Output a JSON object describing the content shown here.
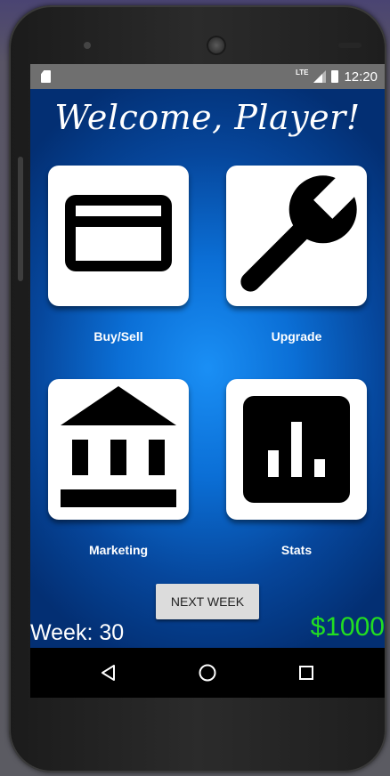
{
  "status_bar": {
    "network": "LTE",
    "time": "12:20"
  },
  "header": {
    "title": "Welcome, Player!"
  },
  "menu": {
    "tiles": [
      {
        "label": "Buy/Sell",
        "icon": "credit-card-icon"
      },
      {
        "label": "Upgrade",
        "icon": "wrench-icon"
      },
      {
        "label": "Marketing",
        "icon": "bank-building-icon"
      },
      {
        "label": "Stats",
        "icon": "bar-chart-icon"
      }
    ]
  },
  "actions": {
    "next_week_label": "NEXT WEEK"
  },
  "footer": {
    "week_text": "Week: 30",
    "money_text": "$1000"
  },
  "nav_bar": {
    "buttons": [
      "back-icon",
      "home-icon",
      "recents-icon"
    ]
  },
  "colors": {
    "background_center": "#1a8ff5",
    "background_edge": "#032f73",
    "money": "#22dd22",
    "tile": "#ffffff",
    "icon": "#000000"
  }
}
